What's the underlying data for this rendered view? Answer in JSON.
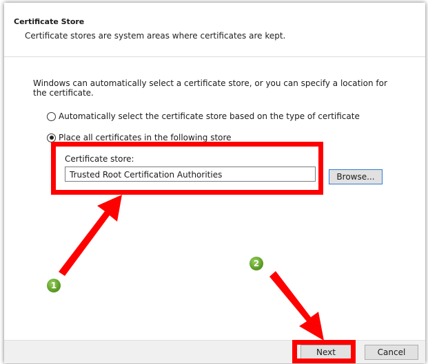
{
  "header": {
    "title": "Certificate Store",
    "subtitle": "Certificate stores are system areas where certificates are kept."
  },
  "main": {
    "intro": "Windows can automatically select a certificate store, or you can specify a location for the certificate.",
    "options": [
      {
        "label": "Automatically select the certificate store based on the type of certificate",
        "selected": false
      },
      {
        "label": "Place all certificates in the following store",
        "selected": true
      }
    ],
    "store_label": "Certificate store:",
    "store_value": "Trusted Root Certification Authorities",
    "browse_label": "Browse..."
  },
  "footer": {
    "next_label": "Next",
    "cancel_label": "Cancel"
  },
  "annotations": {
    "badges": [
      "1",
      "2"
    ],
    "highlight_color": "#ff0000",
    "badge_color": "#5c9e25"
  }
}
